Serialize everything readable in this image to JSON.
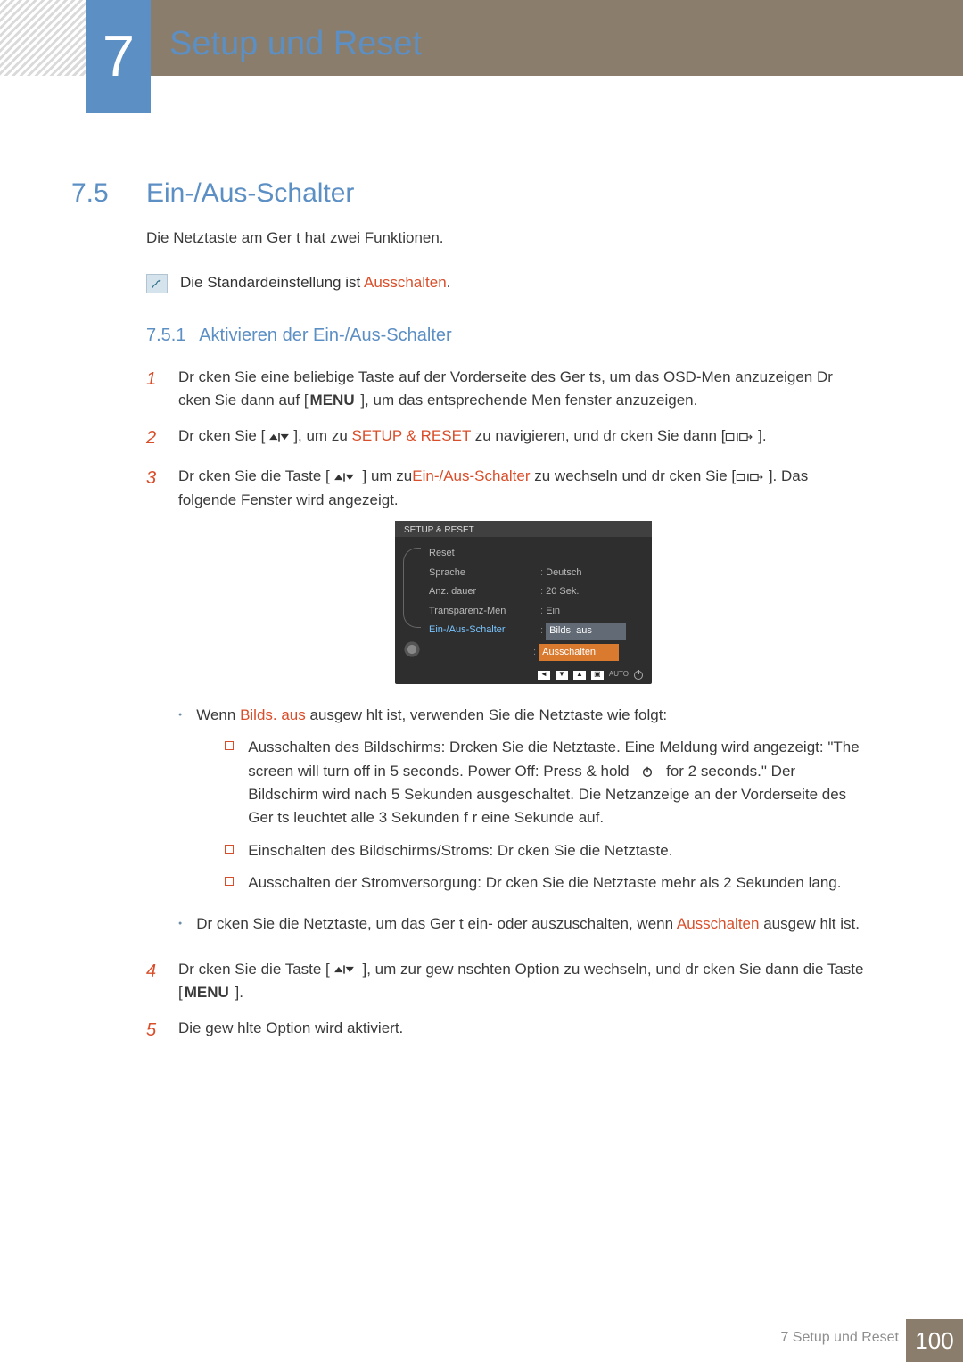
{
  "chapter": {
    "number": "7",
    "title": "Setup und Reset"
  },
  "section": {
    "number": "7.5",
    "title": "Ein-/Aus-Schalter"
  },
  "intro": "Die Netztaste am Ger t hat zwei Funktionen.",
  "note_default_prefix": "Die Standardeinstellung ist",
  "note_default_emph": "Ausschalten",
  "note_default_suffix": ".",
  "subsection": {
    "number": "7.5.1",
    "title": "Aktivieren der Ein-/Aus-Schalter"
  },
  "steps": {
    "s1_num": "1",
    "s1_body": "Dr cken Sie eine beliebige Taste auf der Vorderseite des Ger ts, um das OSD-Men  anzuzeigen Dr cken Sie dann auf [",
    "s1_menu": "MENU",
    "s1_tail": " ], um das entsprechende Men fenster anzuzeigen.",
    "s2_num": "2",
    "s2_a": "Dr cken Sie [",
    "s2_b": "], um zu ",
    "s2_emph": "SETUP & RESET",
    "s2_c": " zu navigieren, und dr cken Sie dann [",
    "s2_d": " ].",
    "s3_num": "3",
    "s3_a": "Dr cken Sie die Taste [",
    "s3_b": " ] um zu",
    "s3_emph": "Ein-/Aus-Schalter",
    "s3_c": " zu wechseln und dr cken Sie [",
    "s3_d": " ]. Das folgende Fenster wird angezeigt."
  },
  "osd": {
    "title": "SETUP & RESET",
    "labels": {
      "l1": "Reset",
      "l2": "Sprache",
      "l3": "Anz. dauer",
      "l4": "Transparenz-Men",
      "l5": "Ein-/Aus-Schalter"
    },
    "values": {
      "v2": "Deutsch",
      "v3": "20 Sek.",
      "v4": "Ein",
      "v5a": "Bilds. aus",
      "v5b": "Ausschalten"
    },
    "footer_auto": "AUTO"
  },
  "bullets": {
    "b1_a": "Wenn ",
    "b1_em": "Bilds. aus",
    "b1_b": " ausgew hlt ist, verwenden Sie die Netztaste wie folgt:",
    "sq1_a": "Ausschalten des Bildschirms: Drcken Sie die Netztaste. Eine Meldung wird angezeigt: \"The screen will turn off in 5 seconds. Power Off: Press & hold",
    "sq1_b": " for 2 seconds.\" Der Bildschirm wird nach 5 Sekunden ausgeschaltet. Die Netzanzeige an der Vorderseite des Ger ts leuchtet alle 3 Sekunden f r eine Sekunde auf.",
    "sq2": "Einschalten des Bildschirms/Stroms: Dr cken Sie die Netztaste.",
    "sq3": "Ausschalten der Stromversorgung: Dr cken Sie die Netztaste mehr als 2 Sekunden lang.",
    "b2_a": "Dr cken Sie die Netztaste, um das Ger t ein- oder auszuschalten, wenn",
    "b2_em": "Ausschalten",
    "b2_b": " ausgew hlt ist."
  },
  "step4": {
    "num": "4",
    "a": "Dr cken Sie die Taste [",
    "b": " ], um zur gew nschten Option zu wechseln, und dr cken Sie dann die Taste [",
    "menu": "MENU",
    "c": " ]."
  },
  "step5": {
    "num": "5",
    "body": "Die gew hlte Option wird aktiviert."
  },
  "footer": {
    "label": "7 Setup und Reset",
    "page": "100"
  }
}
